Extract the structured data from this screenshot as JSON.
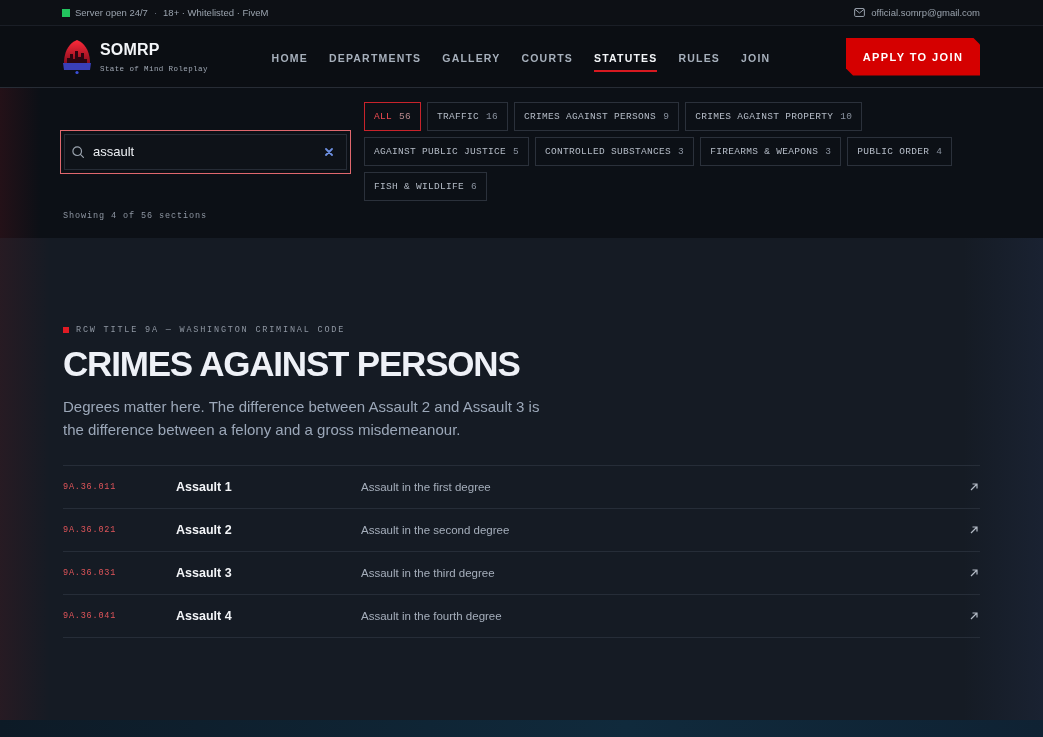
{
  "top_bar": {
    "status": {
      "label": "Server open 24/7",
      "online": true
    },
    "separator": "·",
    "info": "18+ · Whitelisted · FiveM",
    "email": "official.somrp@gmail.com"
  },
  "header": {
    "brand": "SOMRP",
    "tagline": "State of Mind Roleplay",
    "nav": [
      {
        "label": "HOME",
        "selected": false
      },
      {
        "label": "DEPARTMENTS",
        "selected": false
      },
      {
        "label": "GALLERY",
        "selected": false
      },
      {
        "label": "COURTS",
        "selected": false
      },
      {
        "label": "STATUTES",
        "selected": true
      },
      {
        "label": "RULES",
        "selected": false
      },
      {
        "label": "JOIN",
        "selected": false
      }
    ],
    "cta": "APPLY TO JOIN"
  },
  "filters": {
    "search": {
      "value": "assault",
      "focused": true
    },
    "chips": [
      {
        "label": "ALL",
        "count": "56",
        "selected": true
      },
      {
        "label": "TRAFFIC",
        "count": "16",
        "selected": false
      },
      {
        "label": "CRIMES AGAINST PERSONS",
        "count": "9",
        "selected": false
      },
      {
        "label": "CRIMES AGAINST PROPERTY",
        "count": "10",
        "selected": false
      },
      {
        "label": "AGAINST PUBLIC JUSTICE",
        "count": "5",
        "selected": false
      },
      {
        "label": "CONTROLLED SUBSTANCES",
        "count": "3",
        "selected": false
      },
      {
        "label": "FIREARMS & WEAPONS",
        "count": "3",
        "selected": false
      },
      {
        "label": "PUBLIC ORDER",
        "count": "4",
        "selected": false
      },
      {
        "label": "FISH & WILDLIFE",
        "count": "6",
        "selected": false
      }
    ],
    "result_count": "Showing 4 of 56 sections"
  },
  "section": {
    "eyebrow": "RCW TITLE 9A — WASHINGTON CRIMINAL CODE",
    "title": "CRIMES AGAINST PERSONS",
    "description": "Degrees matter here. The difference between Assault 2 and Assault 3 is the difference between a felony and a gross misdemeanour.",
    "statutes": [
      {
        "code": "9A.36.011",
        "title": "Assault 1",
        "description": "Assault in the first degree"
      },
      {
        "code": "9A.36.021",
        "title": "Assault 2",
        "description": "Assault in the second degree"
      },
      {
        "code": "9A.36.031",
        "title": "Assault 3",
        "description": "Assault in the third degree"
      },
      {
        "code": "9A.36.041",
        "title": "Assault 4",
        "description": "Assault in the fourth degree"
      }
    ]
  }
}
